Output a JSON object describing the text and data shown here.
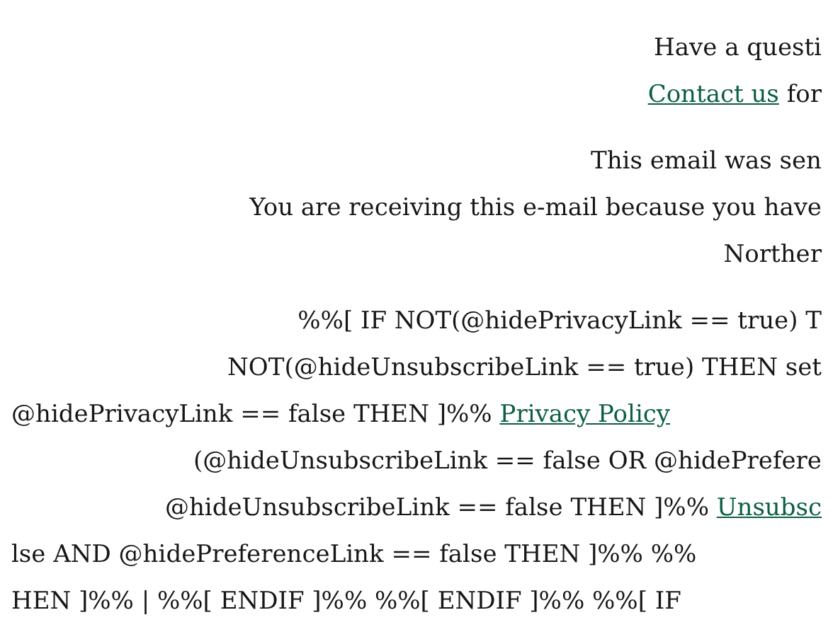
{
  "paragraphs": [
    {
      "lines": [
        {
          "clipped_left": false,
          "segments": [
            {
              "kind": "text",
              "text": "Have a questi"
            }
          ]
        },
        {
          "clipped_left": false,
          "segments": [
            {
              "kind": "link",
              "text": "Contact us"
            },
            {
              "kind": "text",
              "text": "for"
            }
          ]
        }
      ]
    },
    {
      "lines": [
        {
          "clipped_left": false,
          "segments": [
            {
              "kind": "text",
              "text": "This email was sen"
            }
          ]
        },
        {
          "clipped_left": false,
          "segments": [
            {
              "kind": "text",
              "text": "You are receiving this e-mail because you have"
            }
          ]
        },
        {
          "clipped_left": false,
          "segments": [
            {
              "kind": "text",
              "text": "Norther"
            }
          ]
        }
      ]
    },
    {
      "lines": [
        {
          "clipped_left": false,
          "segments": [
            {
              "kind": "text",
              "text": "%%[ IF NOT(@hidePrivacyLink == true) T"
            }
          ]
        },
        {
          "clipped_left": false,
          "segments": [
            {
              "kind": "text",
              "text": "NOT(@hideUnsubscribeLink == true) THEN set"
            }
          ]
        },
        {
          "clipped_left": true,
          "segments": [
            {
              "kind": "text",
              "text": "@hidePrivacyLink == false THEN ]%%"
            },
            {
              "kind": "link",
              "text": "Privacy Policy"
            }
          ]
        },
        {
          "clipped_left": false,
          "segments": [
            {
              "kind": "text",
              "text": "(@hideUnsubscribeLink == false OR @hidePrefere"
            }
          ]
        },
        {
          "clipped_left": false,
          "segments": [
            {
              "kind": "text",
              "text": "@hideUnsubscribeLink == false THEN ]%%"
            },
            {
              "kind": "link",
              "text": "Unsubsc"
            }
          ]
        },
        {
          "clipped_left": true,
          "segments": [
            {
              "kind": "text",
              "text": "lse AND @hidePreferenceLink == false THEN ]%% %%"
            }
          ]
        },
        {
          "clipped_left": true,
          "segments": [
            {
              "kind": "text",
              "text": "HEN ]%% | %%[ ENDIF ]%% %%[ ENDIF ]%% %%[ IF"
            }
          ]
        }
      ]
    }
  ]
}
